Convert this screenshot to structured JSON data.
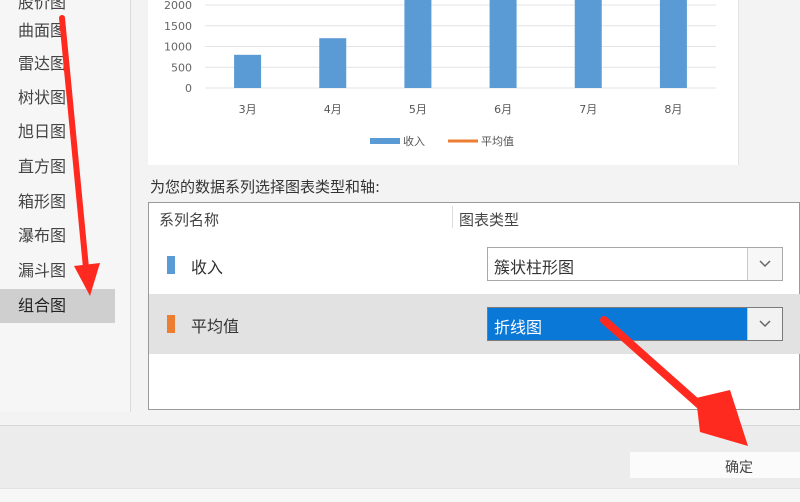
{
  "sidebar": {
    "items": [
      {
        "label": "股价图"
      },
      {
        "label": "曲面图"
      },
      {
        "label": "雷达图"
      },
      {
        "label": "树状图"
      },
      {
        "label": "旭日图"
      },
      {
        "label": "直方图"
      },
      {
        "label": "箱形图"
      },
      {
        "label": "瀑布图"
      },
      {
        "label": "漏斗图"
      },
      {
        "label": "组合图",
        "selected": true
      }
    ]
  },
  "chart_data": {
    "type": "bar",
    "categories": [
      "3月",
      "4月",
      "5月",
      "6月",
      "7月",
      "8月"
    ],
    "series": [
      {
        "name": "收入",
        "type": "bar",
        "color": "#5b9bd5",
        "values": [
          800,
          1200,
          2500,
          2500,
          2500,
          2500
        ]
      },
      {
        "name": "平均值",
        "type": "line",
        "color": "#ed7d31",
        "values": []
      }
    ],
    "yticks": [
      "0",
      "500",
      "1000",
      "1500",
      "2000"
    ],
    "ylim": [
      0,
      2000
    ],
    "grid": true,
    "legend_position": "bottom"
  },
  "prompt": "为您的数据系列选择图表类型和轴:",
  "table": {
    "col_series_name": "系列名称",
    "col_chart_type": "图表类型",
    "rows": [
      {
        "name": "收入",
        "color": "#5b9bd5",
        "chart_type": "簇状柱形图",
        "selected": false
      },
      {
        "name": "平均值",
        "color": "#ed7d31",
        "chart_type": "折线图",
        "selected": true
      }
    ]
  },
  "footer": {
    "ok_label": "确定"
  },
  "colors": {
    "accent_blue": "#0a78d7",
    "annotation_arrow": "#ff2a1f"
  },
  "icons": {
    "dropdown": "chevron-down-icon",
    "annotation": "red-arrow-icon"
  }
}
